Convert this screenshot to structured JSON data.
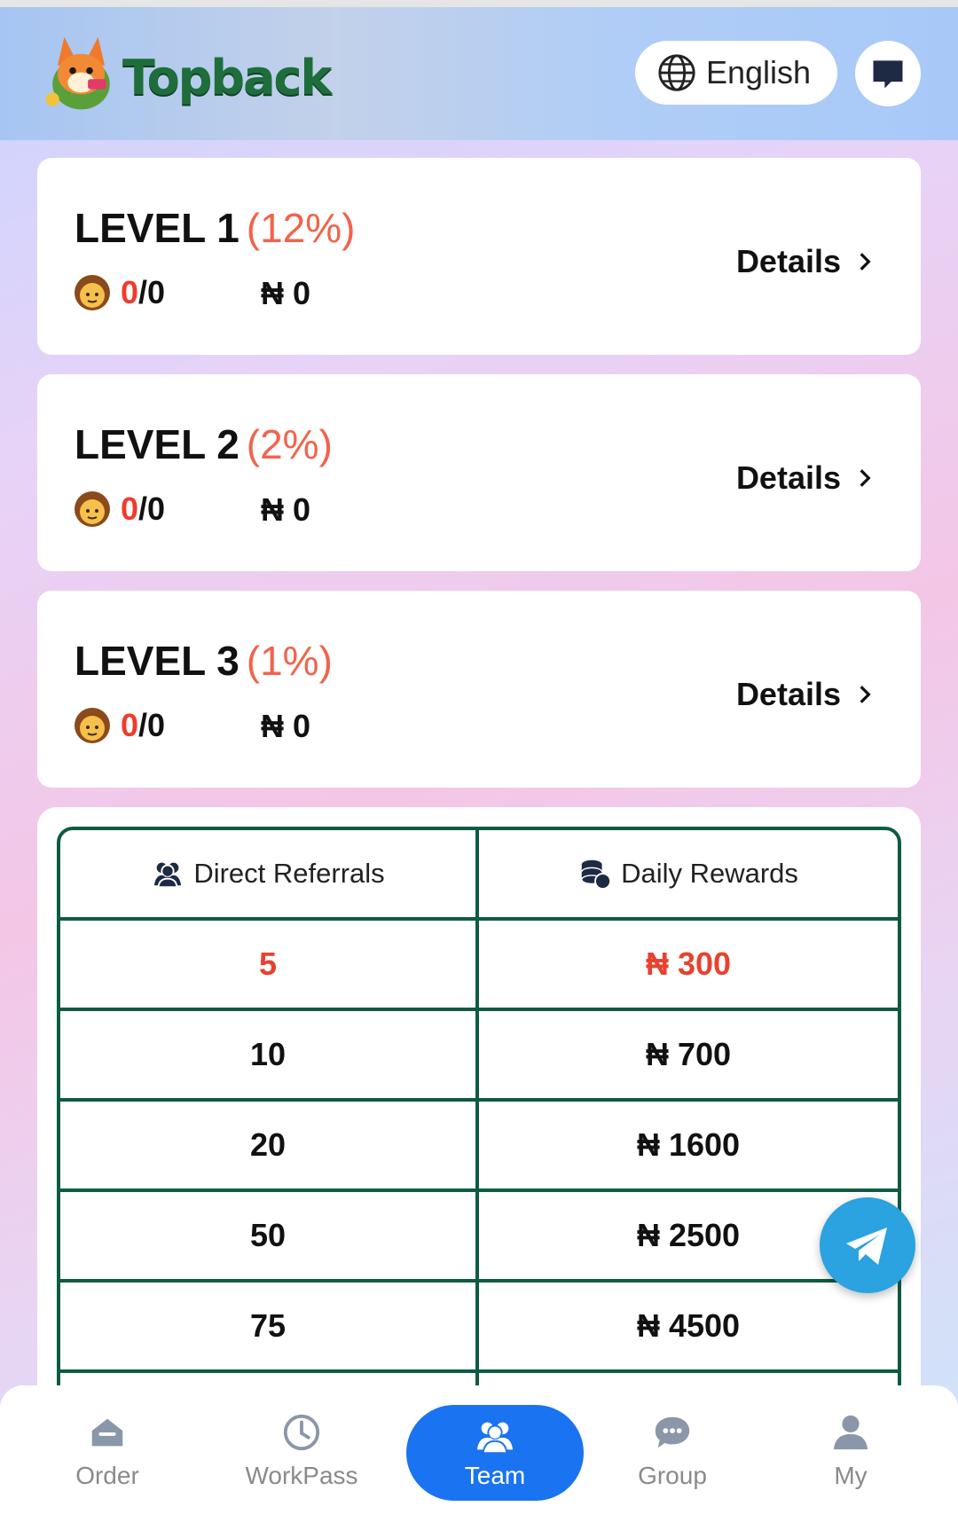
{
  "header": {
    "brand": "Topback",
    "language_label": "English",
    "icons": {
      "language": "globe-icon",
      "chat": "chat-bubble-icon"
    }
  },
  "levels": [
    {
      "title": "LEVEL 1",
      "percent": "(12%)",
      "count_done": "0",
      "count_total": "/0",
      "amount": "₦ 0",
      "details_label": "Details"
    },
    {
      "title": "LEVEL 2",
      "percent": "(2%)",
      "count_done": "0",
      "count_total": "/0",
      "amount": "₦ 0",
      "details_label": "Details"
    },
    {
      "title": "LEVEL 3",
      "percent": "(1%)",
      "count_done": "0",
      "count_total": "/0",
      "amount": "₦ 0",
      "details_label": "Details"
    }
  ],
  "rewards_table": {
    "headers": {
      "referrals": "Direct Referrals",
      "rewards": "Daily Rewards"
    },
    "rows": [
      {
        "referrals": "5",
        "reward": "₦ 300"
      },
      {
        "referrals": "10",
        "reward": "₦ 700"
      },
      {
        "referrals": "20",
        "reward": "₦ 1600"
      },
      {
        "referrals": "50",
        "reward": "₦ 2500"
      },
      {
        "referrals": "75",
        "reward": "₦ 4500"
      },
      {
        "referrals": "",
        "reward": ""
      }
    ]
  },
  "nav": {
    "items": [
      {
        "label": "Order",
        "icon": "order-icon"
      },
      {
        "label": "WorkPass",
        "icon": "clock-icon"
      },
      {
        "label": "Team",
        "icon": "team-icon",
        "active": true
      },
      {
        "label": "Group",
        "icon": "group-chat-icon"
      },
      {
        "label": "My",
        "icon": "user-icon"
      }
    ]
  },
  "colors": {
    "accent_red": "#ef3b2d",
    "percent_orange": "#f0644c",
    "table_border": "#0f5a45",
    "nav_active": "#1a73f0",
    "telegram": "#2aa3e0"
  }
}
